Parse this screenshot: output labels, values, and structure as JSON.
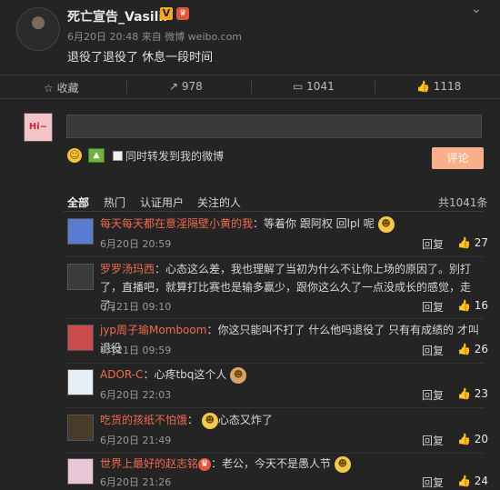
{
  "post": {
    "author": "死亡宣告_Vasilii",
    "verified_badge": "V",
    "meta": "6月20日 20:48 来自 微博 weibo.com",
    "text": "退役了退役了 休息一段时间",
    "menu_icon": "chevron-down-icon"
  },
  "actions": {
    "favorite": "收藏",
    "forward": "978",
    "comment": "1041",
    "like": "1118"
  },
  "composer": {
    "avatar_text": "Hi~",
    "placeholder": "",
    "repost_label": "同时转发到我的微博",
    "submit": "评论"
  },
  "tabs": {
    "all": "全部",
    "hot": "热门",
    "verified": "认证用户",
    "following": "关注的人",
    "total": "共1041条"
  },
  "comments": [
    {
      "name": "每天每天都在意淫隔壁小黄的我",
      "text": "：等着你 跟阿权 回lpl 呢",
      "time": "6月20日 20:59",
      "reply": "回复",
      "likes": "27"
    },
    {
      "name": "罗罗汤玛西",
      "text": "：心态这么差，我也理解了当初为什么不让你上场的原因了。别打了，直播吧，就算打比赛也是输多赢少，跟你这么久了一点没成长的感觉，走了。",
      "time": "6月21日 09:10",
      "reply": "回复",
      "likes": "16"
    },
    {
      "name": "jyp周子瑜Momboom",
      "text": "：你这只能叫不打了 什么他吗退役了 只有有成绩的 才叫退役",
      "time": "6月21日 09:59",
      "reply": "回复",
      "likes": "26"
    },
    {
      "name": "ADOR-C",
      "text": "：心疼tbq这个人",
      "time": "6月20日 22:03",
      "reply": "回复",
      "likes": "23"
    },
    {
      "name": "吃货的孩纸不怕饿",
      "text": "：",
      "text2": "心态又炸了",
      "time": "6月20日 21:49",
      "reply": "回复",
      "likes": "20"
    },
    {
      "name": "世界上最好的赵志铭",
      "text": "：老公，今天不是愚人节",
      "time": "6月20日 21:26",
      "reply": "回复",
      "likes": "24"
    }
  ]
}
